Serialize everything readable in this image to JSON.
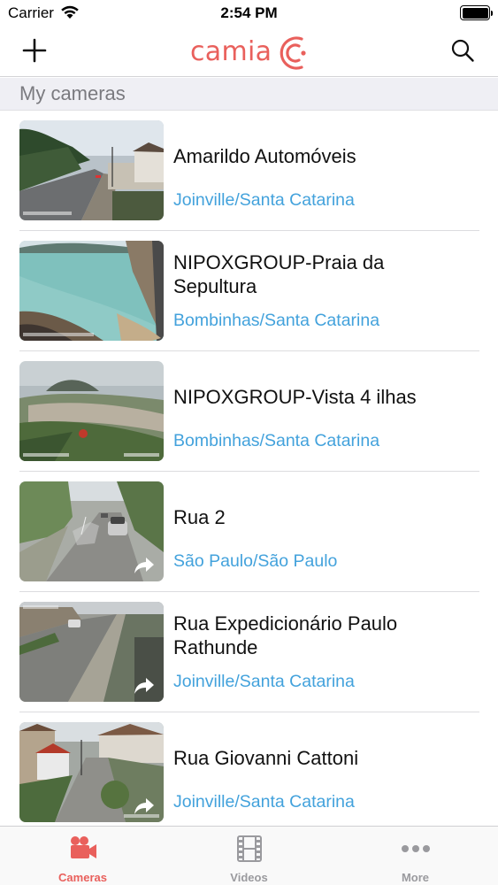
{
  "status_bar": {
    "carrier": "Carrier",
    "time": "2:54 PM"
  },
  "nav": {
    "logo_text": "camia",
    "brand_color": "#e9605c"
  },
  "section": {
    "title": "My cameras"
  },
  "cameras": [
    {
      "name": "Amarildo Automóveis",
      "location": "Joinville/Santa Catarina",
      "shared": false,
      "thumb": "street-hill"
    },
    {
      "name": "NIPOXGROUP-Praia da Sepultura",
      "location": "Bombinhas/Santa Catarina",
      "shared": false,
      "thumb": "beach"
    },
    {
      "name": "NIPOXGROUP-Vista 4 ilhas",
      "location": "Bombinhas/Santa Catarina",
      "shared": false,
      "thumb": "hill-view"
    },
    {
      "name": "Rua 2",
      "location": "São Paulo/São Paulo",
      "shared": true,
      "thumb": "cobblestone-street"
    },
    {
      "name": "Rua Expedicionário Paulo Rathunde",
      "location": "Joinville/Santa Catarina",
      "shared": true,
      "thumb": "road"
    },
    {
      "name": "Rua Giovanni Cattoni",
      "location": "Joinville/Santa Catarina",
      "shared": true,
      "thumb": "houses"
    }
  ],
  "tabs": [
    {
      "label": "Cameras",
      "icon": "camera-icon",
      "active": true
    },
    {
      "label": "Videos",
      "icon": "film-icon",
      "active": false
    },
    {
      "label": "More",
      "icon": "more-icon",
      "active": false
    }
  ],
  "colors": {
    "accent": "#e9605c",
    "link": "#43a2dc",
    "tab_inactive": "#9a9a9e"
  }
}
